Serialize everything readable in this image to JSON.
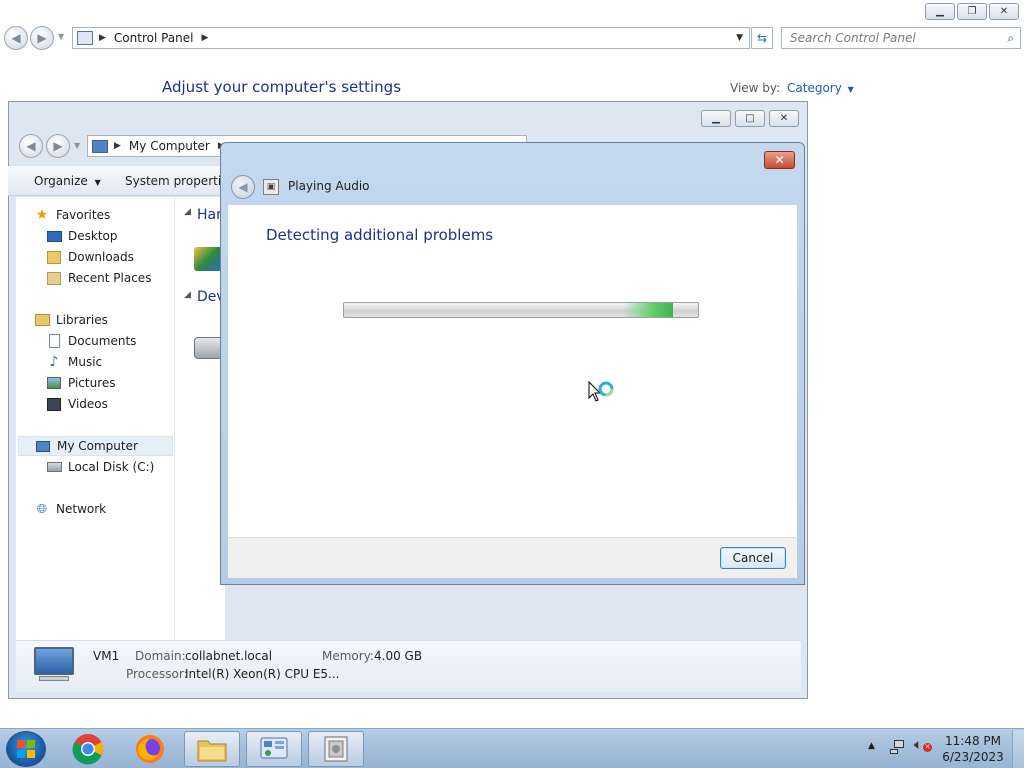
{
  "control_panel": {
    "address_crumb": "Control Panel",
    "search_placeholder": "Search Control Panel",
    "heading": "Adjust your computer's settings",
    "view_by_label": "View by:",
    "view_by_value": "Category"
  },
  "my_computer": {
    "address_crumb": "My Computer",
    "toolbar": {
      "organize": "Organize",
      "system_properties": "System properties"
    },
    "content_headings": [
      "Har",
      "Dev"
    ],
    "nav": {
      "favorites": "Favorites",
      "desktop": "Desktop",
      "downloads": "Downloads",
      "recent_places": "Recent Places",
      "libraries": "Libraries",
      "documents": "Documents",
      "music": "Music",
      "pictures": "Pictures",
      "videos": "Videos",
      "my_computer": "My Computer",
      "local_disk": "Local Disk (C:)",
      "network": "Network"
    },
    "details": {
      "name": "VM1",
      "domain_label": "Domain:",
      "domain_value": "collabnet.local",
      "memory_label": "Memory:",
      "memory_value": "4.00 GB",
      "processor_label": "Processor:",
      "processor_value": "Intel(R) Xeon(R) CPU E5..."
    }
  },
  "dialog": {
    "title": "Playing Audio",
    "heading": "Detecting additional problems",
    "progress_pulse_position": 0.93,
    "cancel_label": "Cancel"
  },
  "taskbar": {
    "time": "11:48 PM",
    "date": "6/23/2023"
  },
  "colors": {
    "heading_blue": "#1e3287",
    "link_blue": "#1e5ab4",
    "progress_green": "#5fd06a",
    "taskbar": "#a7c0dc"
  }
}
